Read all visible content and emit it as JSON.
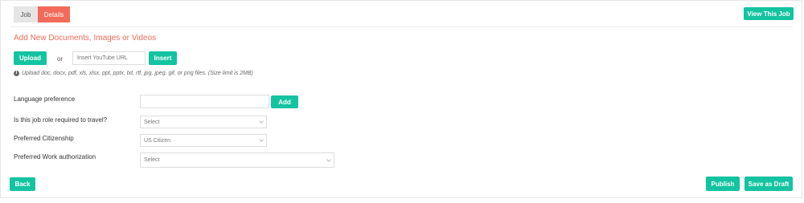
{
  "tabs": [
    {
      "label": "Job",
      "active": false
    },
    {
      "label": "Details",
      "active": true
    }
  ],
  "header": {
    "view_job_label": "View This Job"
  },
  "upload_section": {
    "title": "Add New Documents, Images or Videos",
    "upload_label": "Upload",
    "or_text": "or",
    "youtube_placeholder": "Insert YouTube URL",
    "insert_label": "Insert",
    "hint": "Upload doc, docx, pdf, xls, xlsx, ppt, pptx, txt, rtf, jpg, jpeg, gif, or png files. (Size limit is 2MB)"
  },
  "form": {
    "language": {
      "label": "Language preference",
      "value": "",
      "add_label": "Add"
    },
    "travel": {
      "label": "Is this job role required to travel?",
      "selected": "Select"
    },
    "citizenship": {
      "label": "Preferred Citizenship",
      "selected": "US Citizen"
    },
    "work_auth": {
      "label": "Preferred Work authorization",
      "selected": "Select"
    }
  },
  "footer": {
    "back_label": "Back",
    "publish_label": "Publish",
    "draft_label": "Save as Draft"
  },
  "colors": {
    "accent": "#14c3a0",
    "tab_active": "#f26b5a",
    "title": "#f26b5a"
  }
}
